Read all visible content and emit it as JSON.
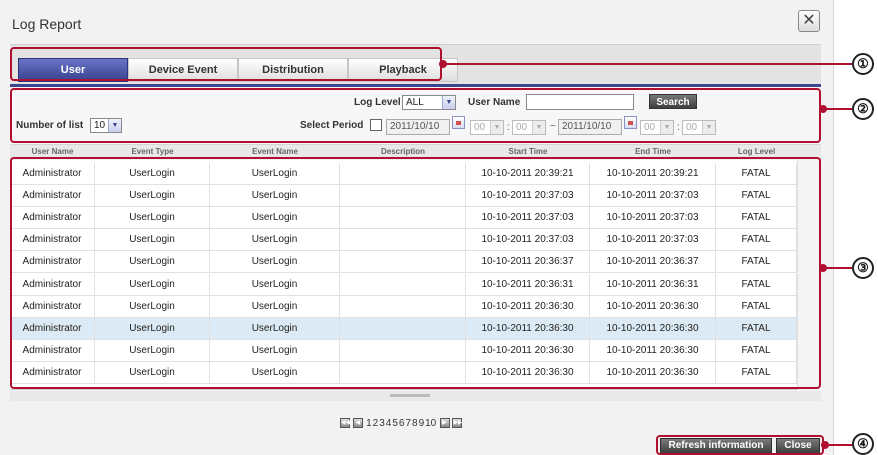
{
  "window": {
    "title": "Log Report",
    "close_glyph": "✕"
  },
  "tabs": [
    {
      "label": "User",
      "active": true
    },
    {
      "label": "Device Event",
      "active": false
    },
    {
      "label": "Distribution",
      "active": false
    },
    {
      "label": "Playback",
      "active": false
    }
  ],
  "filter": {
    "log_level_label": "Log Level",
    "log_level_value": "ALL",
    "user_name_label": "User Name",
    "user_name_value": "",
    "search_label": "Search",
    "number_of_list_label": "Number of list",
    "number_of_list_value": "10",
    "select_period_label": "Select Period",
    "period_enabled": false,
    "start_date": "2011/10/10",
    "start_hour": "00",
    "start_min": "00",
    "time_sep": ":",
    "range_sep": "~",
    "end_date": "2011/10/10",
    "end_hour": "00",
    "end_min": "00"
  },
  "table": {
    "columns": [
      "User Name",
      "Event Type",
      "Event Name",
      "Description",
      "Start Time",
      "End Time",
      "Log Level"
    ],
    "rows": [
      {
        "user": "Administrator",
        "type": "UserLogin",
        "name": "UserLogin",
        "desc": "",
        "start": "10-10-2011 20:39:21",
        "end": "10-10-2011 20:39:21",
        "level": "FATAL"
      },
      {
        "user": "Administrator",
        "type": "UserLogin",
        "name": "UserLogin",
        "desc": "",
        "start": "10-10-2011 20:37:03",
        "end": "10-10-2011 20:37:03",
        "level": "FATAL"
      },
      {
        "user": "Administrator",
        "type": "UserLogin",
        "name": "UserLogin",
        "desc": "",
        "start": "10-10-2011 20:37:03",
        "end": "10-10-2011 20:37:03",
        "level": "FATAL"
      },
      {
        "user": "Administrator",
        "type": "UserLogin",
        "name": "UserLogin",
        "desc": "",
        "start": "10-10-2011 20:37:03",
        "end": "10-10-2011 20:37:03",
        "level": "FATAL"
      },
      {
        "user": "Administrator",
        "type": "UserLogin",
        "name": "UserLogin",
        "desc": "",
        "start": "10-10-2011 20:36:37",
        "end": "10-10-2011 20:36:37",
        "level": "FATAL"
      },
      {
        "user": "Administrator",
        "type": "UserLogin",
        "name": "UserLogin",
        "desc": "",
        "start": "10-10-2011 20:36:31",
        "end": "10-10-2011 20:36:31",
        "level": "FATAL"
      },
      {
        "user": "Administrator",
        "type": "UserLogin",
        "name": "UserLogin",
        "desc": "",
        "start": "10-10-2011 20:36:30",
        "end": "10-10-2011 20:36:30",
        "level": "FATAL"
      },
      {
        "user": "Administrator",
        "type": "UserLogin",
        "name": "UserLogin",
        "desc": "",
        "start": "10-10-2011 20:36:30",
        "end": "10-10-2011 20:36:30",
        "level": "FATAL"
      },
      {
        "user": "Administrator",
        "type": "UserLogin",
        "name": "UserLogin",
        "desc": "",
        "start": "10-10-2011 20:36:30",
        "end": "10-10-2011 20:36:30",
        "level": "FATAL"
      },
      {
        "user": "Administrator",
        "type": "UserLogin",
        "name": "UserLogin",
        "desc": "",
        "start": "10-10-2011 20:36:30",
        "end": "10-10-2011 20:36:30",
        "level": "FATAL"
      }
    ],
    "selected_row": 7
  },
  "pager": {
    "first": "◀◀",
    "prev": "◀",
    "pages": [
      "1",
      "2",
      "3",
      "4",
      "5",
      "6",
      "7",
      "8",
      "9",
      "10"
    ],
    "next": "▶",
    "last": "▶▶"
  },
  "footer": {
    "refresh_label": "Refresh information",
    "close_label": "Close"
  },
  "callouts": [
    "①",
    "②",
    "③",
    "④"
  ],
  "colors": {
    "tab_active": "#3a448f",
    "callout": "#b01030",
    "selected_row": "#dbeaf4"
  }
}
